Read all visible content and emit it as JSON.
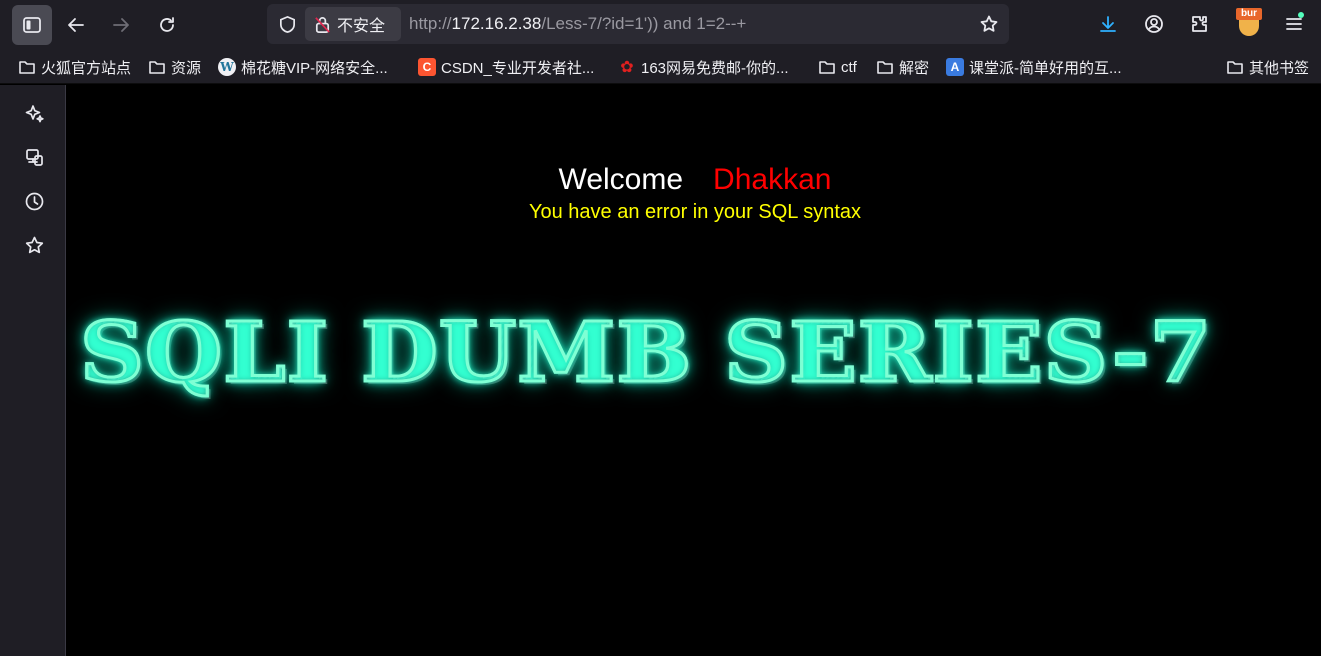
{
  "toolbar": {
    "url_insecure_label": "不安全",
    "url_prefix": "http://",
    "url_host": "172.16.2.38",
    "url_path": "/Less-7/?id=1')) and 1=2--+",
    "extension_badge": "bur"
  },
  "bookmarks": [
    {
      "label": "火狐官方站点",
      "icon": "folder-icon"
    },
    {
      "label": "资源",
      "icon": "folder-icon"
    },
    {
      "label": "棉花糖VIP-网络安全...",
      "icon": "wordpress-icon"
    },
    {
      "label": "CSDN_专业开发者社...",
      "icon": "csdn-icon"
    },
    {
      "label": "163网易免费邮-你的...",
      "icon": "163-icon"
    },
    {
      "label": "ctf",
      "icon": "folder-icon"
    },
    {
      "label": "解密",
      "icon": "folder-icon"
    },
    {
      "label": "课堂派-简单好用的互...",
      "icon": "ketangpai-icon"
    },
    {
      "label": "其他书签",
      "icon": "folder-icon"
    }
  ],
  "favicons": {
    "wp": "W",
    "csdn": "C",
    "ketangpai": "A"
  },
  "page": {
    "welcome": "Welcome",
    "name": "Dhakkan",
    "error": "You have an error in your SQL syntax",
    "banner": "SQLI DUMB SERIES-7"
  },
  "colors": {
    "welcome_name": "#ff0000",
    "error_text": "#ffff00",
    "banner_glow": "#33ffd1"
  }
}
